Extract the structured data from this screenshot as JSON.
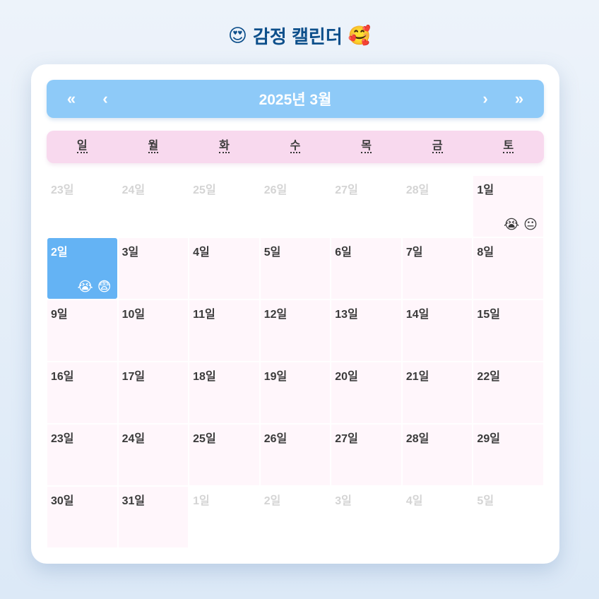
{
  "header": {
    "title": "감정 캘린더",
    "left_emoji": "😍",
    "right_emoji": "🥰"
  },
  "nav": {
    "prev_year": "«",
    "prev_month": "‹",
    "label": "2025년 3월",
    "next_month": "›",
    "next_year": "»"
  },
  "weekdays": [
    "일",
    "월",
    "화",
    "수",
    "목",
    "금",
    "토"
  ],
  "colors": {
    "nav_bg": "#8ecaf8",
    "weekday_bg": "#f8d9ee",
    "day_bg": "#fff6fb",
    "today_bg": "#64b3f4",
    "title": "#0d4f8b"
  },
  "days": [
    {
      "label": "23일",
      "other": true,
      "emojis": []
    },
    {
      "label": "24일",
      "other": true,
      "emojis": []
    },
    {
      "label": "25일",
      "other": true,
      "emojis": []
    },
    {
      "label": "26일",
      "other": true,
      "emojis": []
    },
    {
      "label": "27일",
      "other": true,
      "emojis": []
    },
    {
      "label": "28일",
      "other": true,
      "emojis": []
    },
    {
      "label": "1일",
      "other": false,
      "emojis": [
        "😭",
        "😐"
      ]
    },
    {
      "label": "2일",
      "other": false,
      "today": true,
      "emojis": [
        "😭",
        "😨"
      ]
    },
    {
      "label": "3일",
      "other": false,
      "emojis": []
    },
    {
      "label": "4일",
      "other": false,
      "emojis": []
    },
    {
      "label": "5일",
      "other": false,
      "emojis": []
    },
    {
      "label": "6일",
      "other": false,
      "emojis": []
    },
    {
      "label": "7일",
      "other": false,
      "emojis": []
    },
    {
      "label": "8일",
      "other": false,
      "emojis": []
    },
    {
      "label": "9일",
      "other": false,
      "emojis": []
    },
    {
      "label": "10일",
      "other": false,
      "emojis": []
    },
    {
      "label": "11일",
      "other": false,
      "emojis": []
    },
    {
      "label": "12일",
      "other": false,
      "emojis": []
    },
    {
      "label": "13일",
      "other": false,
      "emojis": []
    },
    {
      "label": "14일",
      "other": false,
      "emojis": []
    },
    {
      "label": "15일",
      "other": false,
      "emojis": []
    },
    {
      "label": "16일",
      "other": false,
      "emojis": []
    },
    {
      "label": "17일",
      "other": false,
      "emojis": []
    },
    {
      "label": "18일",
      "other": false,
      "emojis": []
    },
    {
      "label": "19일",
      "other": false,
      "emojis": []
    },
    {
      "label": "20일",
      "other": false,
      "emojis": []
    },
    {
      "label": "21일",
      "other": false,
      "emojis": []
    },
    {
      "label": "22일",
      "other": false,
      "emojis": []
    },
    {
      "label": "23일",
      "other": false,
      "emojis": []
    },
    {
      "label": "24일",
      "other": false,
      "emojis": []
    },
    {
      "label": "25일",
      "other": false,
      "emojis": []
    },
    {
      "label": "26일",
      "other": false,
      "emojis": []
    },
    {
      "label": "27일",
      "other": false,
      "emojis": []
    },
    {
      "label": "28일",
      "other": false,
      "emojis": []
    },
    {
      "label": "29일",
      "other": false,
      "emojis": []
    },
    {
      "label": "30일",
      "other": false,
      "emojis": []
    },
    {
      "label": "31일",
      "other": false,
      "emojis": []
    },
    {
      "label": "1일",
      "other": true,
      "emojis": []
    },
    {
      "label": "2일",
      "other": true,
      "emojis": []
    },
    {
      "label": "3일",
      "other": true,
      "emojis": []
    },
    {
      "label": "4일",
      "other": true,
      "emojis": []
    },
    {
      "label": "5일",
      "other": true,
      "emojis": []
    }
  ]
}
